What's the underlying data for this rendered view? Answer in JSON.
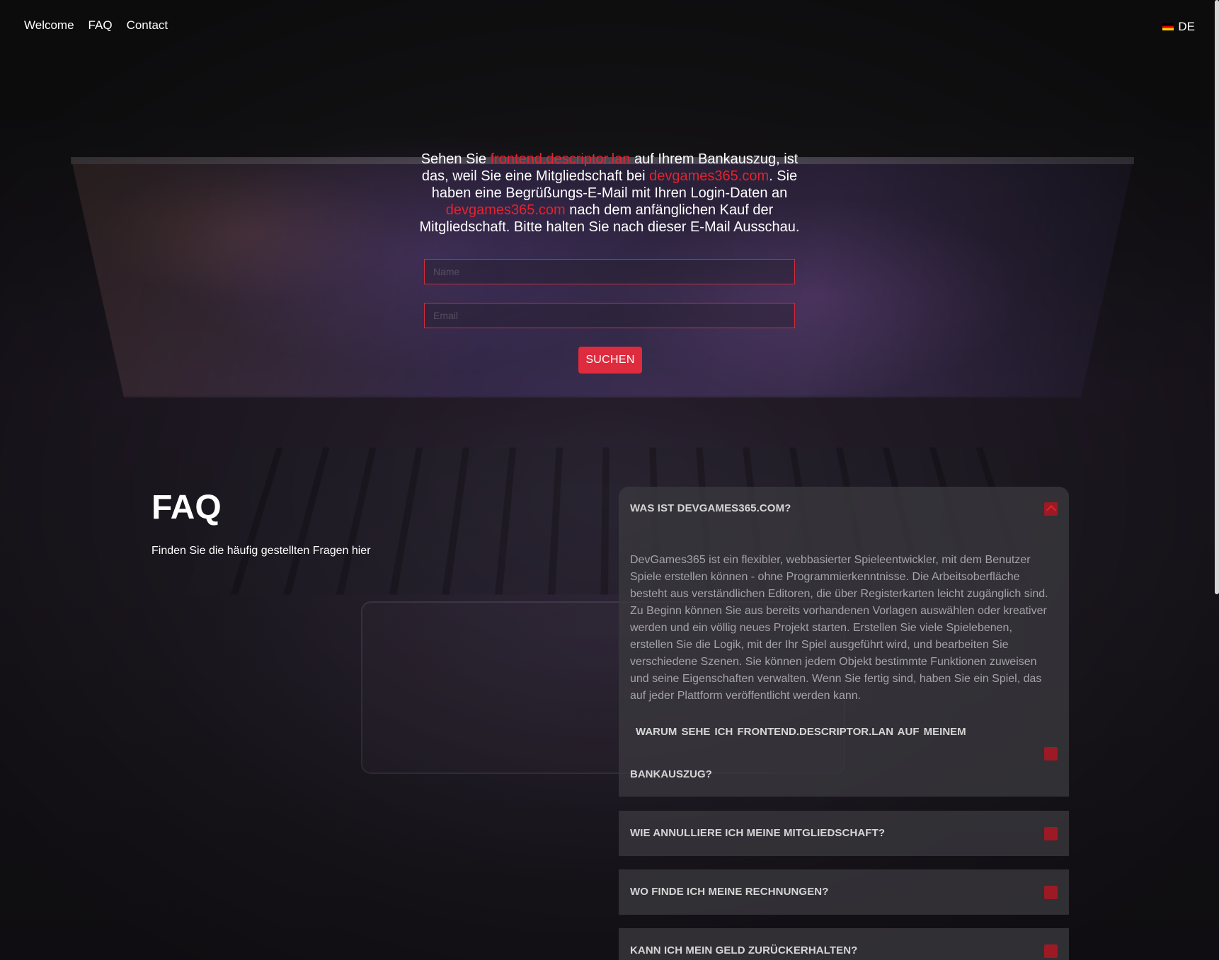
{
  "nav": {
    "items": [
      "Welcome",
      "FAQ",
      "Contact"
    ]
  },
  "language": {
    "code": "DE",
    "flag_icon": "flag-de-icon"
  },
  "hero": {
    "text_parts": [
      "Sehen Sie ",
      "frontend.descriptor.lan",
      " auf Ihrem Bankauszug, ist das, weil Sie eine Mitgliedschaft bei ",
      "devgames365.com",
      ". Sie haben eine Begrüßungs-E-Mail mit Ihren Login-Daten an ",
      "devgames365.com",
      " nach dem anfänglichen Kauf der Mitgliedschaft. Bitte halten Sie nach dieser E-Mail Ausschau."
    ],
    "name_placeholder": "Name",
    "email_placeholder": "Email",
    "search_label": "SUCHEN"
  },
  "faq": {
    "title": "FAQ",
    "subtitle": "Finden Sie die häufig gestellten Fragen hier",
    "items": [
      {
        "question": "WAS IST DEVGAMES365.COM?",
        "answer": "DevGames365 ist ein flexibler, webbasierter Spieleentwickler, mit dem Benutzer Spiele erstellen können - ohne Programmierkenntnisse. Die Arbeitsoberfläche besteht aus verständlichen Editoren, die über Registerkarten leicht zugänglich sind. Zu Beginn können Sie aus bereits vorhandenen Vorlagen auswählen oder kreativer werden und ein völlig neues Projekt starten. Erstellen Sie viele Spielebenen, erstellen Sie die Logik, mit der Ihr Spiel ausgeführt wird, und bearbeiten Sie verschiedene Szenen. Sie können jedem Objekt bestimmte Funktionen zuweisen und seine Eigenschaften verwalten. Wenn Sie fertig sind, haben Sie ein Spiel, das auf jeder Plattform veröffentlicht werden kann.",
        "expanded": true
      },
      {
        "question_line1": "WARUM SEHE ICH FRONTEND.DESCRIPTOR.LAN   AUF MEINEM",
        "question_line2": "BANKAUSZUG?",
        "expanded": false
      },
      {
        "question": "WIE ANNULLIERE ICH MEINE MITGLIEDSCHAFT?",
        "expanded": false
      },
      {
        "question": "WO FINDE ICH MEINE RECHNUNGEN?",
        "expanded": false
      },
      {
        "question": "KANN ICH MEIN GELD ZURÜCKERHALTEN?",
        "expanded": false
      }
    ]
  },
  "colors": {
    "accent": "#de2b3d",
    "link": "#e3232f",
    "background": "#1c1b1e",
    "panel": "#3a383e"
  }
}
